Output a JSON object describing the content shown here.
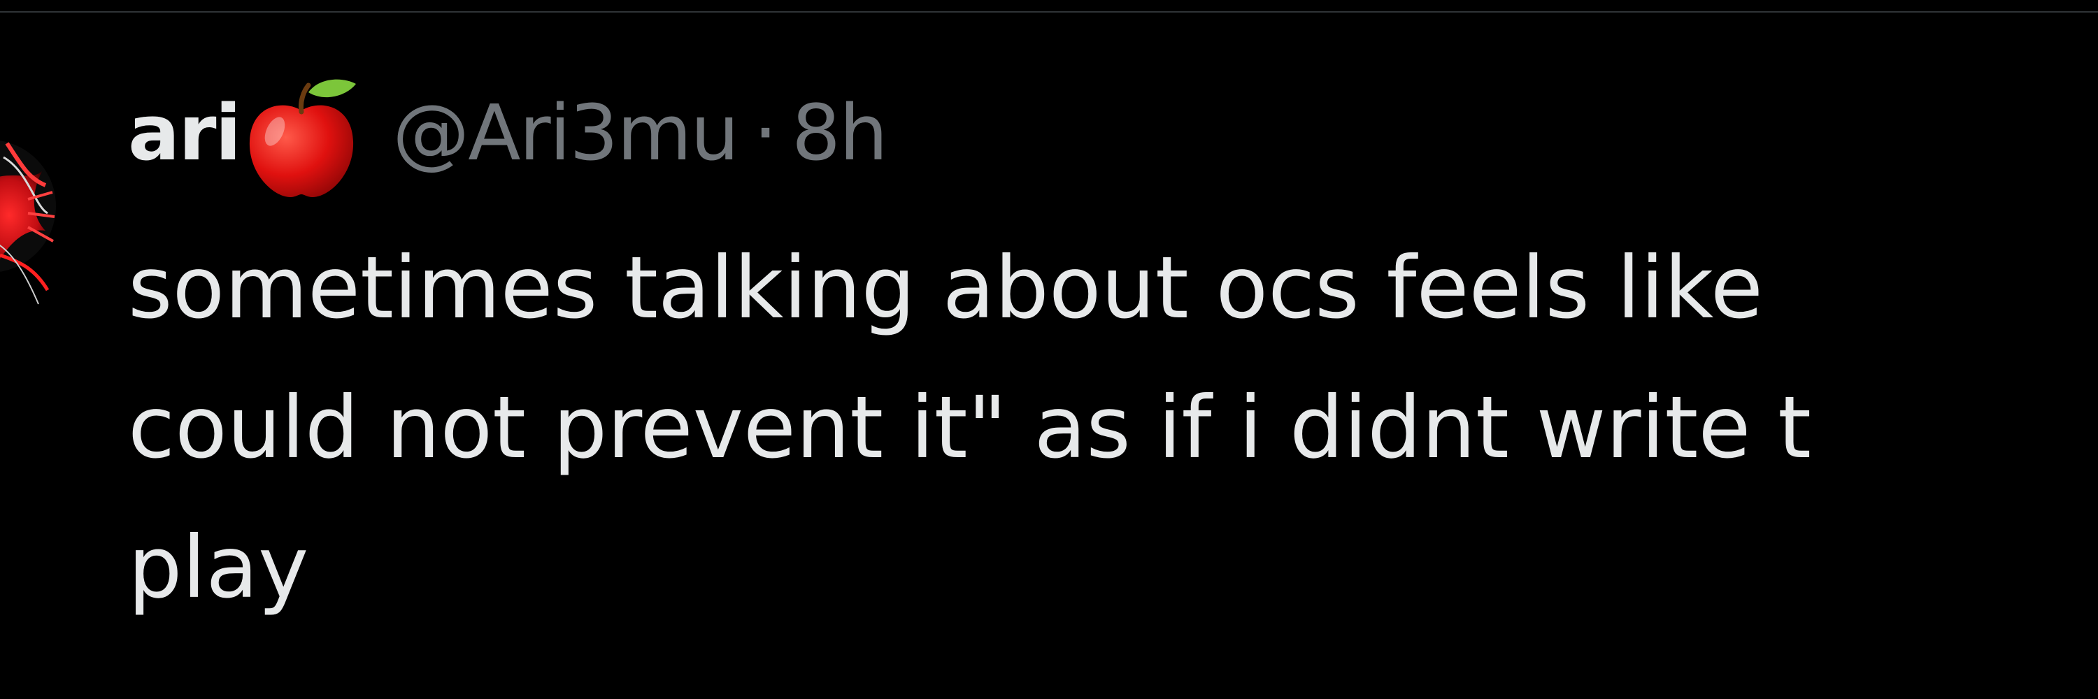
{
  "tweet": {
    "display_name": "ari",
    "name_emoji": "apple-icon",
    "handle": "@Ari3mu",
    "separator": "·",
    "timestamp": "8h",
    "text_lines": [
      "sometimes talking about ocs feels like",
      "could not prevent it\" as if i didnt write t",
      "play"
    ]
  },
  "colors": {
    "background": "#000000",
    "primary_text": "#e7e9ea",
    "secondary_text": "#71767b",
    "divider": "#2f3336",
    "avatar_accent": "#e3131b"
  }
}
